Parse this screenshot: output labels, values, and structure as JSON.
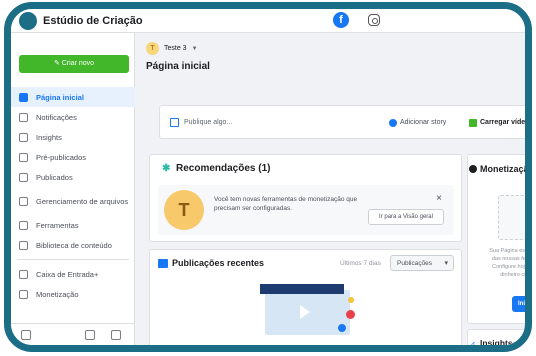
{
  "app": {
    "title": "Estúdio de Criação"
  },
  "header": {
    "platform_icons": [
      "facebook-icon",
      "instagram-icon"
    ],
    "facebook_glyph": "f"
  },
  "sidebar": {
    "create_button": "Criar novo",
    "items": [
      {
        "label": "Página inicial",
        "icon": "home-icon",
        "active": true
      },
      {
        "label": "Notificações",
        "icon": "bell-icon"
      },
      {
        "label": "Insights",
        "icon": "insights-icon"
      },
      {
        "label": "Pré-publicados",
        "icon": "document-icon"
      },
      {
        "label": "Publicados",
        "icon": "calendar-icon"
      },
      {
        "label": "Gerenciamento de arquivos",
        "icon": "file-icon"
      },
      {
        "label": "Ferramentas",
        "icon": "wrench-icon"
      },
      {
        "label": "Biblioteca de conteúdo",
        "icon": "library-icon"
      },
      {
        "label": "Caixa de Entrada+",
        "icon": "inbox-icon"
      },
      {
        "label": "Monetização",
        "icon": "dollar-icon"
      }
    ]
  },
  "page": {
    "selector_avatar": "T",
    "selector_name": "Teste 3",
    "title": "Página inicial"
  },
  "composer": {
    "placeholder": "Publique algo...",
    "story": "Adicionar story",
    "video": "Carregar vídeo"
  },
  "recommendations": {
    "title": "Recomendações (1)",
    "avatar": "T",
    "text": "Você tem novas ferramentas de monetização que precisam ser configuradas.",
    "close": "×",
    "button": "Ir para a Visão geral"
  },
  "publications": {
    "title": "Publicações recentes",
    "period": "Últimos 7 dias",
    "select": "Publicações"
  },
  "monetization": {
    "title": "Monetização",
    "text": [
      "Sua Página está quali",
      "das nossas ferrame",
      "Configure hoje mes",
      "dinheiro com"
    ],
    "button": "Iniciar o"
  },
  "insights_card": {
    "title": "Insights"
  },
  "colors": {
    "frame": "#1b6e86",
    "accent_blue": "#1877f2",
    "create_green": "#42b72a"
  }
}
